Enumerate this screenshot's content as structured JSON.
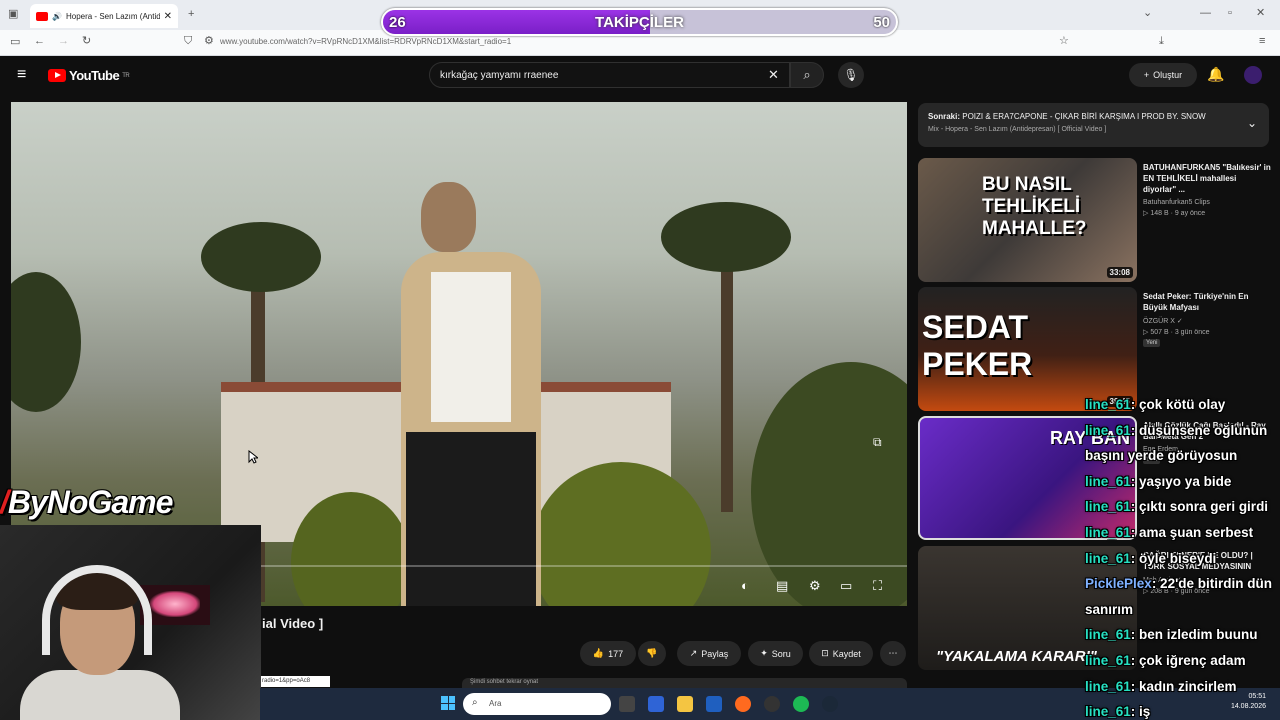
{
  "browser": {
    "tab_title": "Hopera - Sen Lazım (Antide",
    "url": "www.youtube.com/watch?v=RVpRNcD1XM&list=RDRVpRNcD1XM&start_radio=1"
  },
  "overlay": {
    "followers_current": "26",
    "followers_label": "TAKİPÇİLER",
    "followers_goal": "50",
    "followers_progress": 0.52,
    "brand": "ByNoGame"
  },
  "youtube": {
    "logo": "YouTube",
    "logo_region": "TR",
    "search_value": "kırkağaç yamyamı rraenee",
    "create_label": "Oluştur",
    "video_title_fragment": "ial Video ]",
    "actions": {
      "likes": "177",
      "share": "Paylaş",
      "ask": "Soru",
      "save": "Kaydet"
    },
    "up_next": {
      "prefix": "Sonraki:",
      "title": "POIZI & ERA7CAPONE - ÇIKAR BİRİ KARŞIMA I PROD BY. SNOW",
      "playlist": "Mix - Hopera - Sen Lazım (Antidepresan) [ Official Video ]"
    },
    "recommendations": [
      {
        "thumb_text": "BU NASIL TEHLİKELİ MAHALLE?",
        "duration": "33:08",
        "title": "BATUHANFURKAN5 \"Balıkesir' in EN TEHLİKELİ mahallesi diyorlar\" ...",
        "channel": "Batuhanfurkan5 Clips",
        "meta": "▷ 148 B · 9 ay önce"
      },
      {
        "thumb_text": "SEDAT PEKER",
        "duration": "39:45",
        "title": "Sedat Peker: Türkiye'nin En Büyük Mafyası",
        "channel": "ÖZGÜR X ✓",
        "meta": "▷ 507 B · 3 gün önce",
        "badge": "Yeni"
      },
      {
        "thumb_text": "RAY BAN",
        "duration": "",
        "title": "Akıllı Gözlük Çağı Başladı! - Ray Ban Meta Gen 2",
        "channel": "Ege Erdem",
        "meta": "",
        "badge": "Yeni"
      },
      {
        "thumb_text": "\"YAKALAMA KARARI\"",
        "duration": "",
        "title": "ÇAĞRI TANER'E NE OLDU? | TÜRK SOSYAL MEDYASININ",
        "channel": "Meh Arşiv ✓",
        "meta": "▷ 208 B · 9 gün önce"
      }
    ]
  },
  "chat": [
    {
      "user": "line_61",
      "msg": ": çok kötü olay"
    },
    {
      "user": "line_61",
      "msg": ": düşünsene oğlunun"
    },
    {
      "user": "",
      "msg": "başını yerde görüyosun"
    },
    {
      "user": "line_61",
      "msg": ": yaşıyo ya bide"
    },
    {
      "user": "line_61",
      "msg": ": çıktı sonra geri girdi"
    },
    {
      "user": "line_61",
      "msg": ": ama şuan serbest"
    },
    {
      "user": "line_61",
      "msg": ": öyle biseydi"
    },
    {
      "user": "PicklePlex",
      "msg": ": 22'de bitirdin dün"
    },
    {
      "user": "",
      "msg": "sanırım"
    },
    {
      "user": "line_61",
      "msg": ": ben izledim buunu"
    },
    {
      "user": "line_61",
      "msg": ": çok iğrenç adam"
    },
    {
      "user": "line_61",
      "msg": ": kadın zincirlem"
    },
    {
      "user": "line_61",
      "msg": ": iş"
    }
  ],
  "taskbar": {
    "search_placeholder": "Ara",
    "time": "05:51",
    "date": "14.08.2026"
  },
  "misc": {
    "stream_url_fragment": "radio=1&pp=oAc8",
    "comment_fragment": "Şimdi sohbet tekrar oynat"
  }
}
